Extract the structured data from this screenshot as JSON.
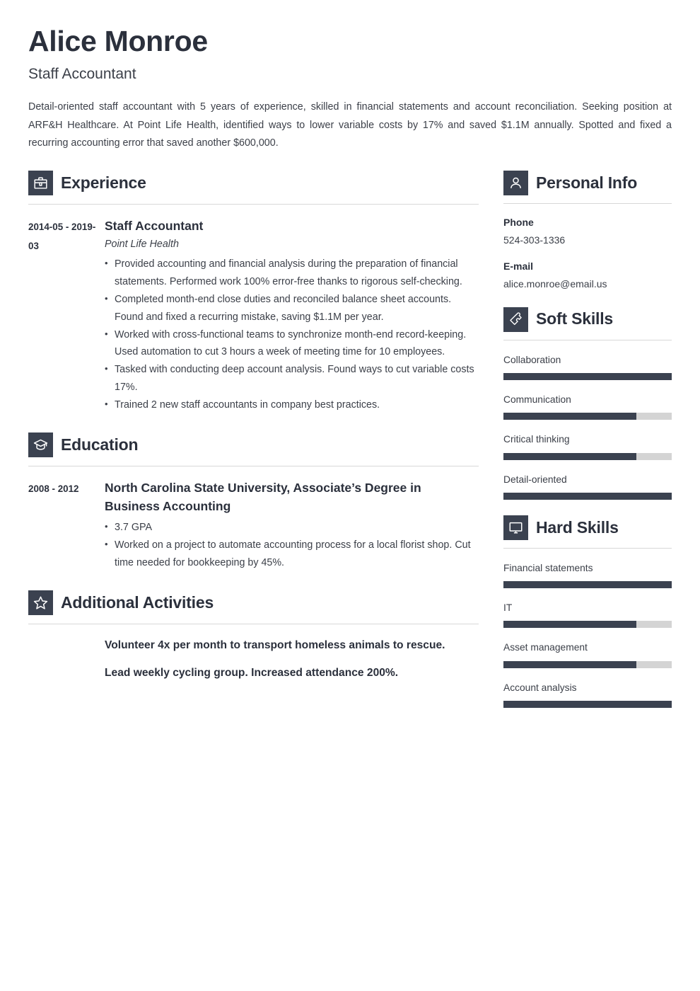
{
  "header": {
    "name": "Alice Monroe",
    "job_title": "Staff Accountant",
    "summary": "Detail-oriented staff accountant with 5 years of experience, skilled in financial statements and account reconciliation. Seeking position at ARF&H Healthcare. At Point Life Health, identified ways to lower variable costs by 17% and saved $1.1M annually. Spotted and fixed a recurring accounting error that saved another $600,000."
  },
  "colors": {
    "accent_dark": "#3b4250",
    "heading": "#2b303c",
    "body_text": "#3c4049",
    "rule": "#d8d8d8",
    "skill_track": "#d4d4d4"
  },
  "sections": {
    "experience": {
      "title": "Experience",
      "icon": "briefcase-icon",
      "entries": [
        {
          "date": "2014-05 - 2019-03",
          "title": "Staff Accountant",
          "subtitle": "Point Life Health",
          "bullets": [
            "Provided accounting and financial analysis during the preparation of financial statements. Performed work 100% error-free thanks to rigorous self-checking.",
            "Completed month-end close duties and reconciled balance sheet accounts. Found and fixed a recurring mistake, saving $1.1M per year.",
            "Worked with cross-functional teams to synchronize month-end record-keeping. Used automation to cut 3 hours a week of meeting time for 10 employees.",
            "Tasked with conducting deep account analysis. Found ways to cut variable costs 17%.",
            "Trained 2 new staff accountants in company best practices."
          ]
        }
      ]
    },
    "education": {
      "title": "Education",
      "icon": "graduation-cap-icon",
      "entries": [
        {
          "date": "2008 - 2012",
          "title": "North Carolina State University, Associate’s Degree in Business Accounting",
          "bullets": [
            "3.7 GPA",
            "Worked on a project to automate accounting process for a local florist shop. Cut time needed for bookkeeping by 45%."
          ]
        }
      ]
    },
    "additional_activities": {
      "title": "Additional Activities",
      "icon": "star-icon",
      "items": [
        "Volunteer 4x per month to transport homeless animals to rescue.",
        "Lead weekly cycling group. Increased attendance 200%."
      ]
    },
    "personal_info": {
      "title": "Personal Info",
      "icon": "person-icon",
      "fields": [
        {
          "label": "Phone",
          "value": "524-303-1336"
        },
        {
          "label": "E-mail",
          "value": "alice.monroe@email.us"
        }
      ]
    },
    "soft_skills": {
      "title": "Soft Skills",
      "icon": "puzzle-piece-icon",
      "skills": [
        {
          "name": "Collaboration",
          "level": 100
        },
        {
          "name": "Communication",
          "level": 79
        },
        {
          "name": "Critical thinking",
          "level": 79
        },
        {
          "name": "Detail-oriented",
          "level": 100
        }
      ]
    },
    "hard_skills": {
      "title": "Hard Skills",
      "icon": "monitor-icon",
      "skills": [
        {
          "name": "Financial statements",
          "level": 100
        },
        {
          "name": "IT",
          "level": 79
        },
        {
          "name": "Asset management",
          "level": 79
        },
        {
          "name": "Account analysis",
          "level": 100
        }
      ]
    }
  }
}
